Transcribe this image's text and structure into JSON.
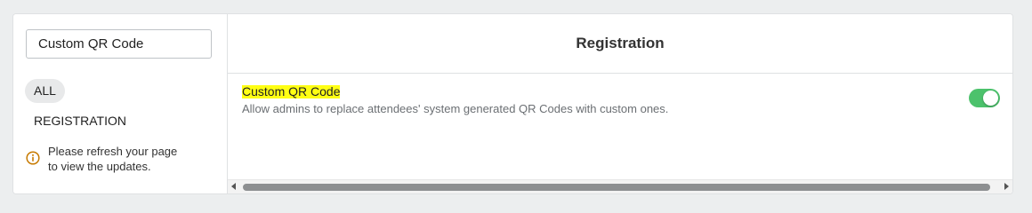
{
  "search": {
    "value": "Custom QR Code"
  },
  "filters": {
    "all_label": "ALL",
    "categories": [
      "REGISTRATION"
    ]
  },
  "notice": {
    "icon": "info-icon",
    "line1": "Please refresh your page",
    "line2": "to view the updates."
  },
  "main": {
    "title": "Registration",
    "settings": [
      {
        "title": "Custom QR Code",
        "description": "Allow admins to replace attendees' system generated QR Codes with custom ones.",
        "enabled": true
      }
    ]
  },
  "colors": {
    "highlight": "#ffff14",
    "toggle_on": "#4cc26c",
    "info_icon": "#c77a00"
  }
}
